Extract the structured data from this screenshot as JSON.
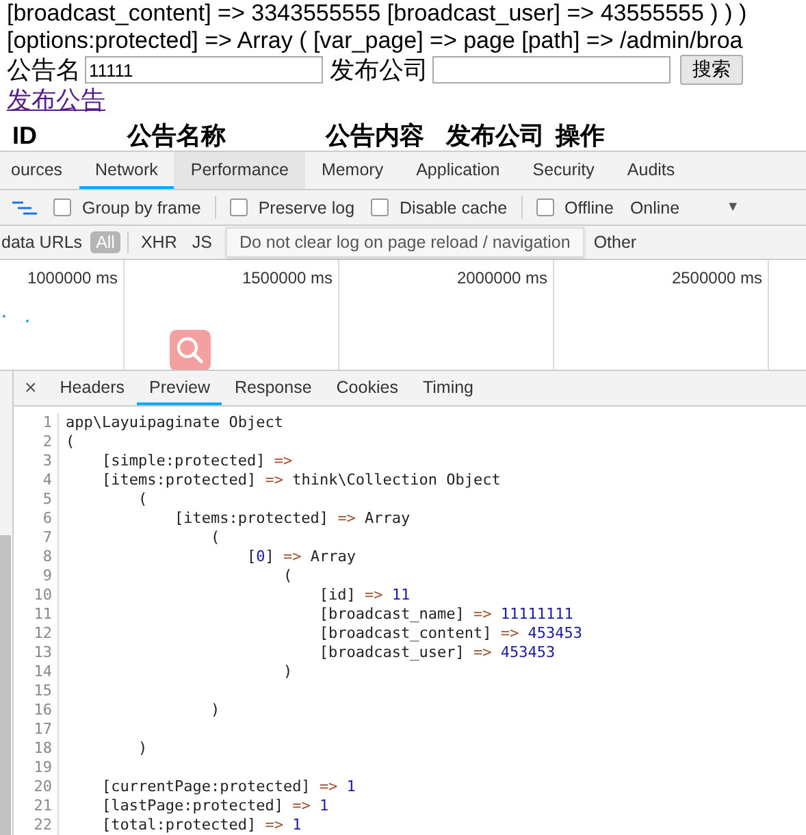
{
  "page": {
    "dump_lines": [
      "[broadcast_content] => 3343555555 [broadcast_user] => 43555555 ) ) )",
      "[options:protected] => Array ( [var_page] => page [path] => /admin/broa"
    ],
    "search_form": {
      "fields": [
        {
          "label": "公告名",
          "value": "11111"
        },
        {
          "label": "发布公司"
        }
      ],
      "button": "搜索"
    },
    "link": "发布公告",
    "table": {
      "columns": [
        "ID",
        "公告名称",
        "公告内容",
        "发布公司",
        "操作"
      ]
    }
  },
  "devtools": {
    "tabs": [
      {
        "label": "ources",
        "selected": false,
        "hovered": false
      },
      {
        "label": "Network",
        "selected": true,
        "hovered": false
      },
      {
        "label": "Performance",
        "selected": false,
        "hovered": true
      },
      {
        "label": "Memory",
        "selected": false,
        "hovered": false
      },
      {
        "label": "Application",
        "selected": false,
        "hovered": false
      },
      {
        "label": "Security",
        "selected": false,
        "hovered": false
      },
      {
        "label": "Audits",
        "selected": false,
        "hovered": false
      }
    ],
    "toolbar": {
      "items": [
        {
          "kind": "icon"
        },
        {
          "kind": "checkbox",
          "label": "Group by frame",
          "checked": false
        },
        {
          "kind": "divider"
        },
        {
          "kind": "checkbox",
          "label": "Preserve log",
          "checked": false
        },
        {
          "kind": "checkbox",
          "label": "Disable cache",
          "checked": false
        },
        {
          "kind": "divider"
        },
        {
          "kind": "checkbox",
          "label": "Offline",
          "checked": false
        },
        {
          "kind": "select",
          "label": "Online",
          "caret": "▼"
        }
      ]
    },
    "filter_bar": {
      "hide_label": "data URLs",
      "filters_before": [
        {
          "label": "All",
          "selected": true
        },
        {
          "label": "XHR",
          "selected": false
        },
        {
          "label": "JS",
          "selected": false
        }
      ],
      "tooltip": "Do not clear log on page reload / navigation",
      "filters_after": [
        {
          "label": "Other",
          "selected": false
        }
      ]
    },
    "timeline": {
      "ticks": [
        "1000000 ms",
        "1500000 ms",
        "2000000 ms",
        "2500000 ms"
      ]
    },
    "details": {
      "close": "×",
      "tabs": [
        {
          "label": "Headers",
          "selected": false
        },
        {
          "label": "Preview",
          "selected": true
        },
        {
          "label": "Response",
          "selected": false
        },
        {
          "label": "Cookies",
          "selected": false
        },
        {
          "label": "Timing",
          "selected": false
        }
      ],
      "lines": [
        {
          "number": "1",
          "tokens": [
            {
              "kind": "text",
              "text": "app\\Layuipaginate Object"
            }
          ]
        },
        {
          "number": "2",
          "tokens": [
            {
              "kind": "text",
              "text": "("
            }
          ]
        },
        {
          "number": "3",
          "tokens": [
            {
              "kind": "text",
              "text": "    [simple:protected] "
            },
            {
              "kind": "arrow",
              "text": "=>"
            }
          ]
        },
        {
          "number": "4",
          "tokens": [
            {
              "kind": "text",
              "text": "    [items:protected] "
            },
            {
              "kind": "arrow",
              "text": "=>"
            },
            {
              "kind": "text",
              "text": " think\\Collection Object"
            }
          ]
        },
        {
          "number": "5",
          "tokens": [
            {
              "kind": "text",
              "text": "        ("
            }
          ]
        },
        {
          "number": "6",
          "tokens": [
            {
              "kind": "text",
              "text": "            [items:protected] "
            },
            {
              "kind": "arrow",
              "text": "=>"
            },
            {
              "kind": "text",
              "text": " Array"
            }
          ]
        },
        {
          "number": "7",
          "tokens": [
            {
              "kind": "text",
              "text": "                ("
            }
          ]
        },
        {
          "number": "8",
          "tokens": [
            {
              "kind": "text",
              "text": "                    ["
            },
            {
              "kind": "number",
              "text": "0"
            },
            {
              "kind": "text",
              "text": "] "
            },
            {
              "kind": "arrow",
              "text": "=>"
            },
            {
              "kind": "text",
              "text": " Array"
            }
          ]
        },
        {
          "number": "9",
          "tokens": [
            {
              "kind": "text",
              "text": "                        ("
            }
          ]
        },
        {
          "number": "10",
          "tokens": [
            {
              "kind": "text",
              "text": "                            [id] "
            },
            {
              "kind": "arrow",
              "text": "=>"
            },
            {
              "kind": "number",
              "text": " 11"
            }
          ]
        },
        {
          "number": "11",
          "tokens": [
            {
              "kind": "text",
              "text": "                            [broadcast_name] "
            },
            {
              "kind": "arrow",
              "text": "=>"
            },
            {
              "kind": "number",
              "text": " 11111111"
            }
          ]
        },
        {
          "number": "12",
          "tokens": [
            {
              "kind": "text",
              "text": "                            [broadcast_content] "
            },
            {
              "kind": "arrow",
              "text": "=>"
            },
            {
              "kind": "number",
              "text": " 453453"
            }
          ]
        },
        {
          "number": "13",
          "tokens": [
            {
              "kind": "text",
              "text": "                            [broadcast_user] "
            },
            {
              "kind": "arrow",
              "text": "=>"
            },
            {
              "kind": "number",
              "text": " 453453"
            }
          ]
        },
        {
          "number": "14",
          "tokens": [
            {
              "kind": "text",
              "text": "                        )"
            }
          ]
        },
        {
          "number": "15"
        },
        {
          "number": "16",
          "tokens": [
            {
              "kind": "text",
              "text": "                )"
            }
          ]
        },
        {
          "number": "17"
        },
        {
          "number": "18",
          "tokens": [
            {
              "kind": "text",
              "text": "        )"
            }
          ]
        },
        {
          "number": "19"
        },
        {
          "number": "20",
          "tokens": [
            {
              "kind": "text",
              "text": "    [currentPage:protected] "
            },
            {
              "kind": "arrow",
              "text": "=>"
            },
            {
              "kind": "number",
              "text": " 1"
            }
          ]
        },
        {
          "number": "21",
          "tokens": [
            {
              "kind": "text",
              "text": "    [lastPage:protected] "
            },
            {
              "kind": "arrow",
              "text": "=>"
            },
            {
              "kind": "number",
              "text": " 1"
            }
          ]
        },
        {
          "number": "22",
          "tokens": [
            {
              "kind": "text",
              "text": "    [total:protected] "
            },
            {
              "kind": "arrow",
              "text": "=>"
            },
            {
              "kind": "number",
              "text": " 1"
            }
          ]
        }
      ]
    }
  }
}
